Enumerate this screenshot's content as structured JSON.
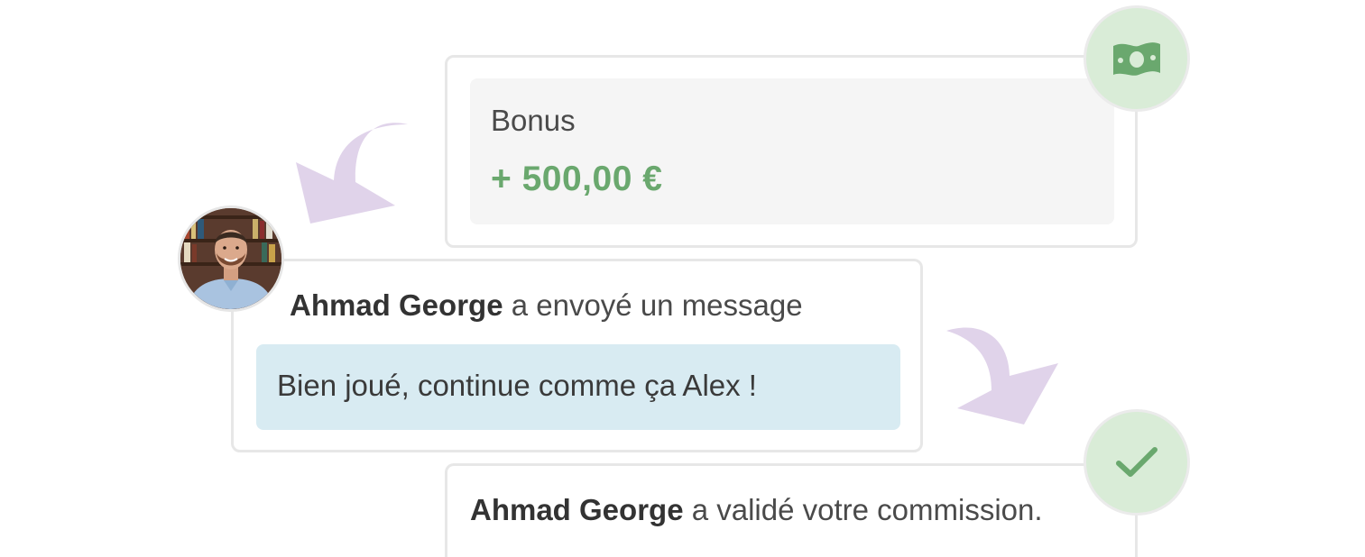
{
  "bonus": {
    "label": "Bonus",
    "amount": "+ 500,00 €",
    "icon": "banknote-icon"
  },
  "message": {
    "sender": "Ahmad George",
    "action": " a envoyé un message",
    "text": "Bien joué, continue comme ça Alex !"
  },
  "validation": {
    "sender": "Ahmad George",
    "action": " a validé votre commission.",
    "icon": "check-icon"
  },
  "colors": {
    "accent_green": "#6aa86e",
    "badge_green": "#d9ecd7",
    "message_bubble": "#d8ebf2",
    "arrow_purple": "#e0d3ea"
  }
}
